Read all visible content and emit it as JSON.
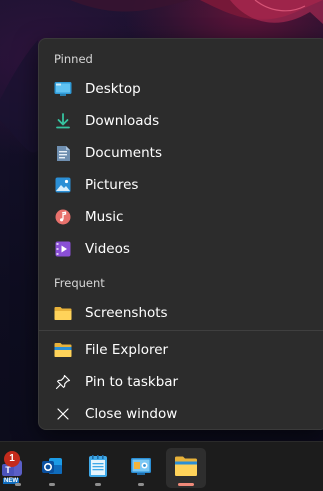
{
  "jump_list": {
    "pinned_header": "Pinned",
    "pinned_items": [
      {
        "label": "Desktop",
        "icon": "desktop-folder-icon"
      },
      {
        "label": "Downloads",
        "icon": "downloads-icon"
      },
      {
        "label": "Documents",
        "icon": "documents-icon"
      },
      {
        "label": "Pictures",
        "icon": "pictures-icon"
      },
      {
        "label": "Music",
        "icon": "music-icon"
      },
      {
        "label": "Videos",
        "icon": "videos-icon"
      }
    ],
    "frequent_header": "Frequent",
    "frequent_items": [
      {
        "label": "Screenshots",
        "icon": "folder-icon"
      }
    ],
    "actions": [
      {
        "label": "File Explorer",
        "icon": "file-explorer-icon"
      },
      {
        "label": "Pin to taskbar",
        "icon": "pin-icon"
      },
      {
        "label": "Close window",
        "icon": "close-icon"
      }
    ]
  },
  "taskbar": {
    "apps": [
      {
        "name": "Microsoft Teams",
        "icon": "teams-icon",
        "badge": "1",
        "badge_text": "NEW"
      },
      {
        "name": "Outlook",
        "icon": "outlook-icon"
      },
      {
        "name": "Notepad",
        "icon": "notepad-icon"
      },
      {
        "name": "Control Panel",
        "icon": "control-panel-icon"
      },
      {
        "name": "File Explorer",
        "icon": "file-explorer-icon",
        "active": true
      }
    ]
  },
  "colors": {
    "menu_bg": "#2c2c2c",
    "taskbar_bg": "#1c1c1c",
    "active_indicator": "#f08a7a",
    "badge": "#c42b1c"
  }
}
